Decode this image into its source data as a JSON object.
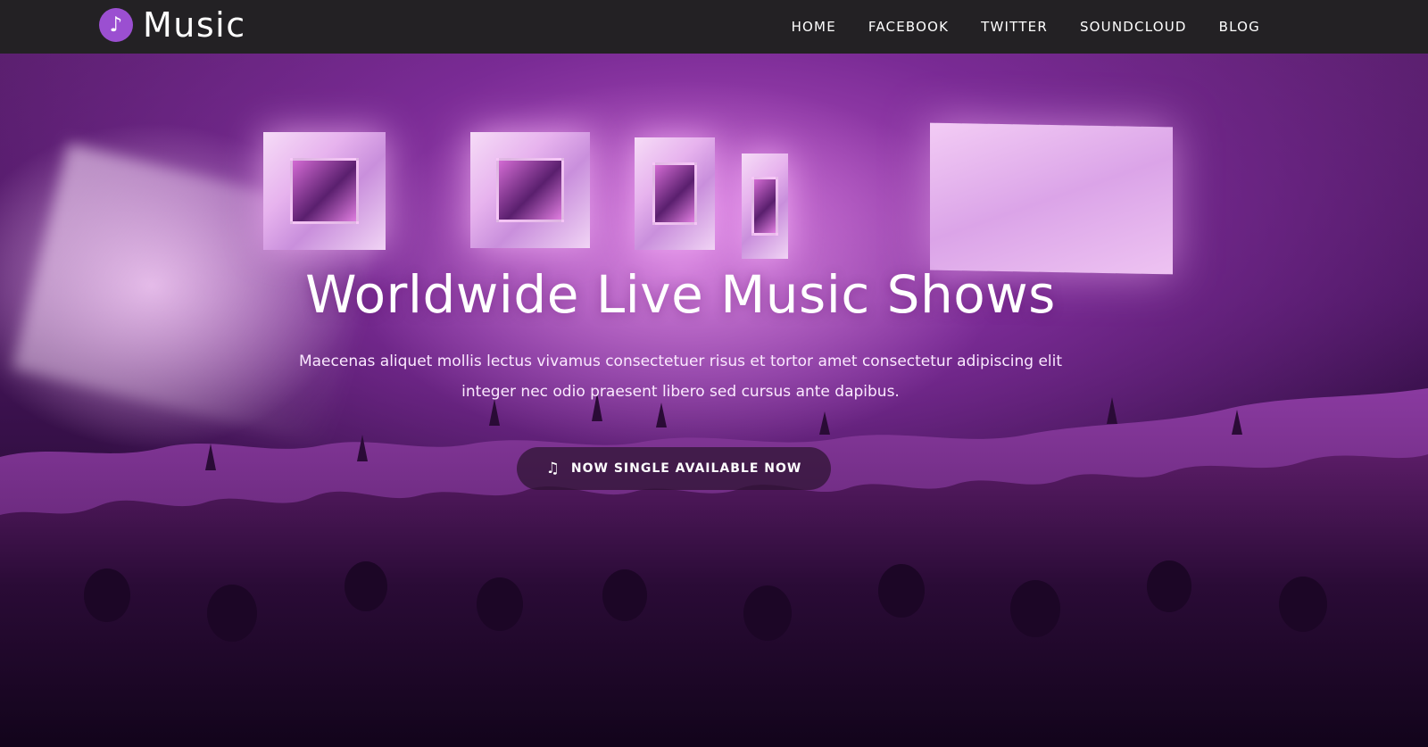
{
  "brand": {
    "icon": "music-note-icon",
    "glyph": "♪",
    "name": "Music",
    "badge_color": "#9b4fd1"
  },
  "nav": {
    "items": [
      {
        "label": "HOME"
      },
      {
        "label": "FACEBOOK"
      },
      {
        "label": "TWITTER"
      },
      {
        "label": "SOUNDCLOUD"
      },
      {
        "label": "BLOG"
      }
    ]
  },
  "hero": {
    "title": "Worldwide Live Music Shows",
    "subtitle": "Maecenas aliquet mollis lectus vivamus consectetuer risus et tortor amet consectetur adipiscing elit integer nec odio praesent libero sed cursus ante dapibus.",
    "cta": {
      "icon": "music-note-icon",
      "glyph": "♫",
      "label": "NOW SINGLE AVAILABLE NOW"
    },
    "background": "concert crowd photo",
    "colors": {
      "primary": "#b04ec0",
      "dark": "#180724"
    }
  }
}
